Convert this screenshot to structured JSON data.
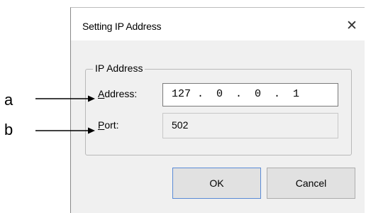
{
  "dialog": {
    "title": "Setting IP Address",
    "close_glyph": "✕",
    "group_label": "IP Address",
    "address": {
      "label_mnemonic": "A",
      "label_rest": "ddress:",
      "value": "127 .  0  .  0  .  1"
    },
    "port": {
      "label_mnemonic": "P",
      "label_rest": "ort:",
      "value": "502"
    },
    "ok_label": "OK",
    "cancel_label": "Cancel"
  },
  "callouts": {
    "a": "a",
    "b": "b"
  }
}
